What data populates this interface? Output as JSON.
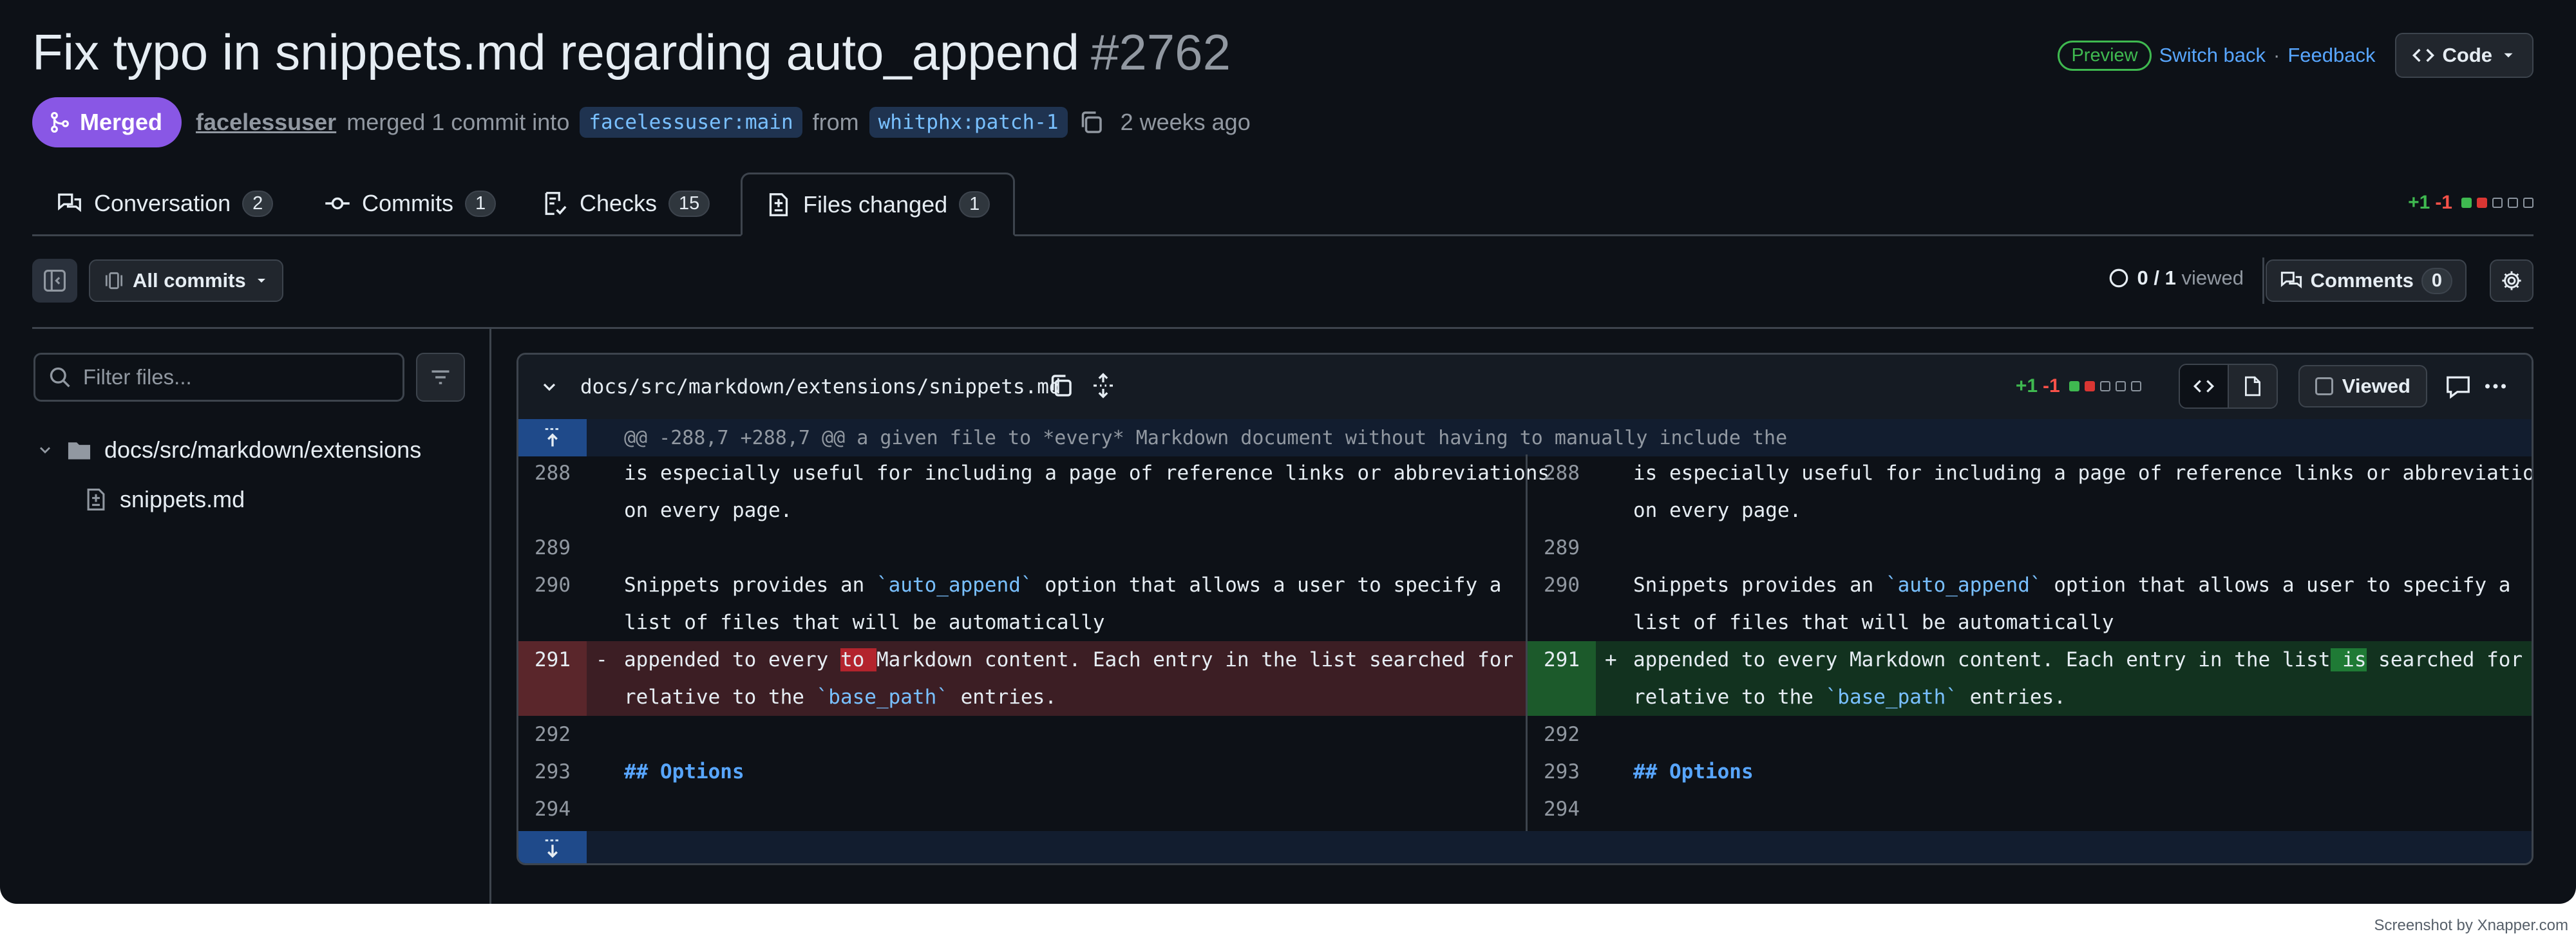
{
  "pr": {
    "title": "Fix typo in snippets.md regarding auto_append",
    "number": "#2762",
    "status": "Merged",
    "author": "facelessuser",
    "merged_text": "merged 1 commit into",
    "base_branch": "facelessuser:main",
    "from_text": "from",
    "head_branch": "whitphx:patch-1",
    "time_ago": "2 weeks ago"
  },
  "header_right": {
    "preview": "Preview",
    "switch_back": "Switch back",
    "separator": "·",
    "feedback": "Feedback",
    "code_button": "Code"
  },
  "tabs": [
    {
      "label": "Conversation",
      "count": "2",
      "icon": "comment-discussion-icon"
    },
    {
      "label": "Commits",
      "count": "1",
      "icon": "git-commit-icon"
    },
    {
      "label": "Checks",
      "count": "15",
      "icon": "checklist-icon"
    },
    {
      "label": "Files changed",
      "count": "1",
      "icon": "file-diff-icon",
      "active": true
    }
  ],
  "diffstat": {
    "additions": "+1",
    "deletions": "-1"
  },
  "toolbar": {
    "all_commits": "All commits",
    "viewed_count": "0",
    "viewed_total": "/ 1",
    "viewed_label": "viewed",
    "comments_label": "Comments",
    "comments_count": "0"
  },
  "sidebar": {
    "filter_placeholder": "Filter files...",
    "folder": "docs/src/markdown/extensions",
    "file": "snippets.md"
  },
  "file": {
    "path": "docs/src/markdown/extensions/snippets.md",
    "additions": "+1",
    "deletions": "-1",
    "viewed_label": "Viewed",
    "hunk_header": "@@ -288,7 +288,7 @@ a given file to *every* Markdown document without having to manually include the"
  },
  "diff": {
    "left": {
      "l288": "288",
      "l289": "289",
      "l290": "290",
      "l291": "291",
      "l292": "292",
      "l293": "293",
      "l294": "294",
      "c288a": "is especially useful for including a page of reference links or abbreviations",
      "c288b": "on every page.",
      "c290a_pre": "Snippets provides an ",
      "c290a_code": "`auto_append`",
      "c290a_post": " option that allows a user to specify a",
      "c290b": "list of files that will be automatically",
      "mark291": "-",
      "c291a_pre": "appended to every ",
      "c291a_hl": "to ",
      "c291a_post": "Markdown content. Each entry in the list searched for",
      "c291b_pre": "relative to the ",
      "c291b_code": "`base_path`",
      "c291b_post": " entries.",
      "c293": "## Options"
    },
    "right": {
      "l288": "288",
      "l289": "289",
      "l290": "290",
      "l291": "291",
      "l292": "292",
      "l293": "293",
      "l294": "294",
      "c288a": "is especially useful for including a page of reference links or abbreviations",
      "c288b": "on every page.",
      "c290a_pre": "Snippets provides an ",
      "c290a_code": "`auto_append`",
      "c290a_post": " option that allows a user to specify a",
      "c290b": "list of files that will be automatically",
      "mark291": "+",
      "c291a_pre": "appended to every Markdown content. Each entry in the list",
      "c291a_hl": " is",
      "c291a_post": " searched for",
      "c291b_pre": "relative to the ",
      "c291b_code": "`base_path`",
      "c291b_post": " entries.",
      "c293": "## Options"
    }
  },
  "watermark": "Screenshot by Xnapper.com",
  "colors": {
    "background": "#0d1117",
    "merged": "#8957e5",
    "addition": "#3fb950",
    "deletion": "#f85149",
    "link": "#58a6ff"
  }
}
